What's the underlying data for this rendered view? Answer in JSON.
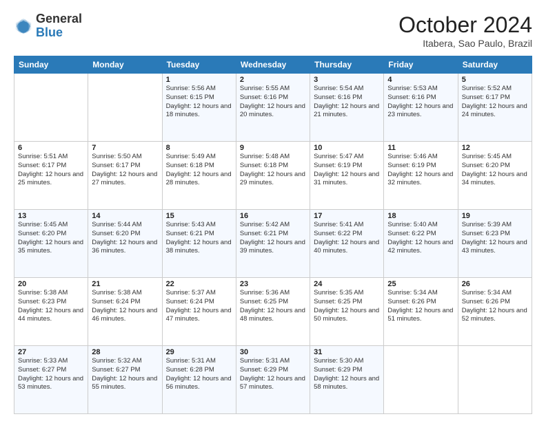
{
  "header": {
    "logo_general": "General",
    "logo_blue": "Blue",
    "month_year": "October 2024",
    "location": "Itabera, Sao Paulo, Brazil"
  },
  "days_of_week": [
    "Sunday",
    "Monday",
    "Tuesday",
    "Wednesday",
    "Thursday",
    "Friday",
    "Saturday"
  ],
  "weeks": [
    [
      {
        "day": "",
        "info": ""
      },
      {
        "day": "",
        "info": ""
      },
      {
        "day": "1",
        "info": "Sunrise: 5:56 AM\nSunset: 6:15 PM\nDaylight: 12 hours and 18 minutes."
      },
      {
        "day": "2",
        "info": "Sunrise: 5:55 AM\nSunset: 6:16 PM\nDaylight: 12 hours and 20 minutes."
      },
      {
        "day": "3",
        "info": "Sunrise: 5:54 AM\nSunset: 6:16 PM\nDaylight: 12 hours and 21 minutes."
      },
      {
        "day": "4",
        "info": "Sunrise: 5:53 AM\nSunset: 6:16 PM\nDaylight: 12 hours and 23 minutes."
      },
      {
        "day": "5",
        "info": "Sunrise: 5:52 AM\nSunset: 6:17 PM\nDaylight: 12 hours and 24 minutes."
      }
    ],
    [
      {
        "day": "6",
        "info": "Sunrise: 5:51 AM\nSunset: 6:17 PM\nDaylight: 12 hours and 25 minutes."
      },
      {
        "day": "7",
        "info": "Sunrise: 5:50 AM\nSunset: 6:17 PM\nDaylight: 12 hours and 27 minutes."
      },
      {
        "day": "8",
        "info": "Sunrise: 5:49 AM\nSunset: 6:18 PM\nDaylight: 12 hours and 28 minutes."
      },
      {
        "day": "9",
        "info": "Sunrise: 5:48 AM\nSunset: 6:18 PM\nDaylight: 12 hours and 29 minutes."
      },
      {
        "day": "10",
        "info": "Sunrise: 5:47 AM\nSunset: 6:19 PM\nDaylight: 12 hours and 31 minutes."
      },
      {
        "day": "11",
        "info": "Sunrise: 5:46 AM\nSunset: 6:19 PM\nDaylight: 12 hours and 32 minutes."
      },
      {
        "day": "12",
        "info": "Sunrise: 5:45 AM\nSunset: 6:20 PM\nDaylight: 12 hours and 34 minutes."
      }
    ],
    [
      {
        "day": "13",
        "info": "Sunrise: 5:45 AM\nSunset: 6:20 PM\nDaylight: 12 hours and 35 minutes."
      },
      {
        "day": "14",
        "info": "Sunrise: 5:44 AM\nSunset: 6:20 PM\nDaylight: 12 hours and 36 minutes."
      },
      {
        "day": "15",
        "info": "Sunrise: 5:43 AM\nSunset: 6:21 PM\nDaylight: 12 hours and 38 minutes."
      },
      {
        "day": "16",
        "info": "Sunrise: 5:42 AM\nSunset: 6:21 PM\nDaylight: 12 hours and 39 minutes."
      },
      {
        "day": "17",
        "info": "Sunrise: 5:41 AM\nSunset: 6:22 PM\nDaylight: 12 hours and 40 minutes."
      },
      {
        "day": "18",
        "info": "Sunrise: 5:40 AM\nSunset: 6:22 PM\nDaylight: 12 hours and 42 minutes."
      },
      {
        "day": "19",
        "info": "Sunrise: 5:39 AM\nSunset: 6:23 PM\nDaylight: 12 hours and 43 minutes."
      }
    ],
    [
      {
        "day": "20",
        "info": "Sunrise: 5:38 AM\nSunset: 6:23 PM\nDaylight: 12 hours and 44 minutes."
      },
      {
        "day": "21",
        "info": "Sunrise: 5:38 AM\nSunset: 6:24 PM\nDaylight: 12 hours and 46 minutes."
      },
      {
        "day": "22",
        "info": "Sunrise: 5:37 AM\nSunset: 6:24 PM\nDaylight: 12 hours and 47 minutes."
      },
      {
        "day": "23",
        "info": "Sunrise: 5:36 AM\nSunset: 6:25 PM\nDaylight: 12 hours and 48 minutes."
      },
      {
        "day": "24",
        "info": "Sunrise: 5:35 AM\nSunset: 6:25 PM\nDaylight: 12 hours and 50 minutes."
      },
      {
        "day": "25",
        "info": "Sunrise: 5:34 AM\nSunset: 6:26 PM\nDaylight: 12 hours and 51 minutes."
      },
      {
        "day": "26",
        "info": "Sunrise: 5:34 AM\nSunset: 6:26 PM\nDaylight: 12 hours and 52 minutes."
      }
    ],
    [
      {
        "day": "27",
        "info": "Sunrise: 5:33 AM\nSunset: 6:27 PM\nDaylight: 12 hours and 53 minutes."
      },
      {
        "day": "28",
        "info": "Sunrise: 5:32 AM\nSunset: 6:27 PM\nDaylight: 12 hours and 55 minutes."
      },
      {
        "day": "29",
        "info": "Sunrise: 5:31 AM\nSunset: 6:28 PM\nDaylight: 12 hours and 56 minutes."
      },
      {
        "day": "30",
        "info": "Sunrise: 5:31 AM\nSunset: 6:29 PM\nDaylight: 12 hours and 57 minutes."
      },
      {
        "day": "31",
        "info": "Sunrise: 5:30 AM\nSunset: 6:29 PM\nDaylight: 12 hours and 58 minutes."
      },
      {
        "day": "",
        "info": ""
      },
      {
        "day": "",
        "info": ""
      }
    ]
  ]
}
